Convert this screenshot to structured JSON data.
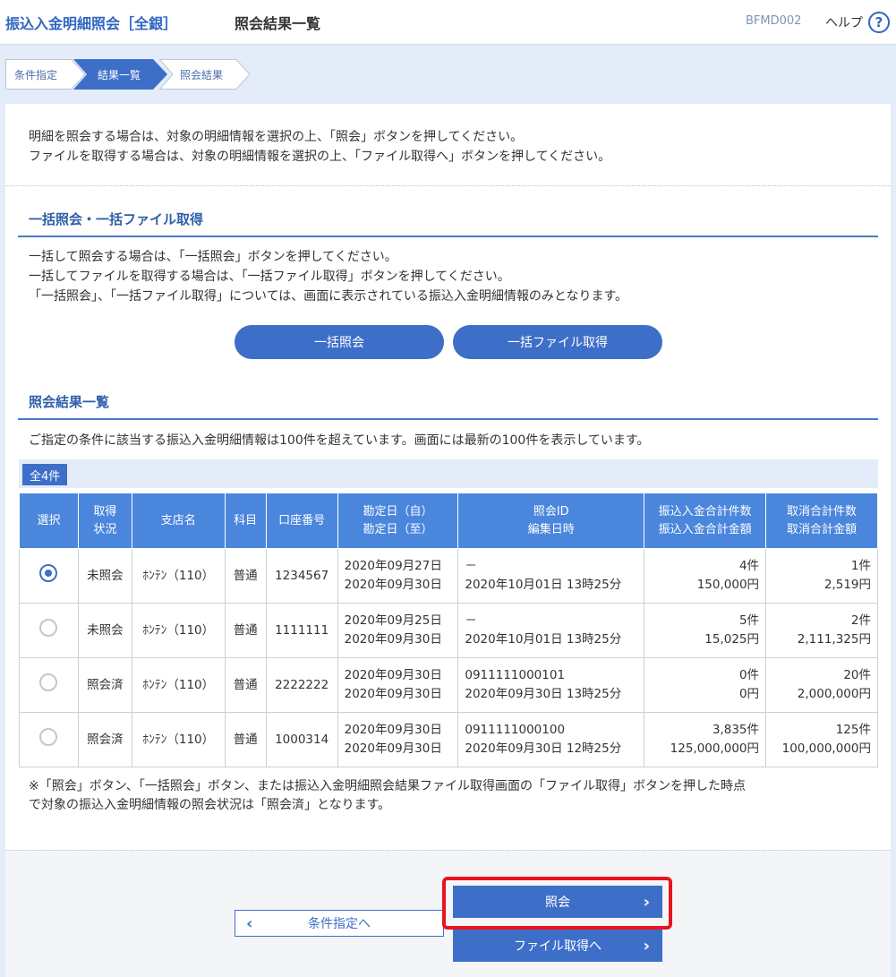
{
  "header": {
    "app_title": "振込入金明細照会［全銀］",
    "page_title": "照会結果一覧",
    "screen_id": "BFMD002",
    "help_label": "ヘルプ",
    "help_icon": "?"
  },
  "steps": [
    {
      "label": "条件指定",
      "state": "done"
    },
    {
      "label": "結果一覧",
      "state": "current"
    },
    {
      "label": "照会結果",
      "state": "pending"
    }
  ],
  "intro": [
    "明細を照会する場合は、対象の明細情報を選択の上、「照会」ボタンを押してください。",
    "ファイルを取得する場合は、対象の明細情報を選択の上、「ファイル取得へ」ボタンを押してください。"
  ],
  "bulk": {
    "title": "一括照会・一括ファイル取得",
    "lines": [
      "一括して照会する場合は、「一括照会」ボタンを押してください。",
      "一括してファイルを取得する場合は、「一括ファイル取得」ボタンを押してください。",
      "「一括照会」、「一括ファイル取得」については、画面に表示されている振込入金明細情報のみとなります。"
    ],
    "bulk_inquiry_label": "一括照会",
    "bulk_file_label": "一括ファイル取得"
  },
  "results": {
    "title": "照会結果一覧",
    "message": "ご指定の条件に該当する振込入金明細情報は100件を超えています。画面には最新の100件を表示しています。",
    "count_badge": "全4件",
    "columns": {
      "select": "選択",
      "status_1": "取得",
      "status_2": "状況",
      "branch": "支店名",
      "subject": "科目",
      "account": "口座番号",
      "date_1": "勘定日（自）",
      "date_2": "勘定日（至）",
      "inquiry_1": "照会ID",
      "inquiry_2": "編集日時",
      "deposit_1": "振込入金合計件数",
      "deposit_2": "振込入金合計金額",
      "cancel_1": "取消合計件数",
      "cancel_2": "取消合計金額"
    },
    "rows": [
      {
        "selected": true,
        "status": "未照会",
        "branch": "ﾎﾝﾃﾝ（110）",
        "subject": "普通",
        "account": "1234567",
        "date_from": "2020年09月27日",
        "date_to": "2020年09月30日",
        "inquiry_id": "－",
        "edited": "2020年10月01日 13時25分",
        "deposit_count": "4件",
        "deposit_amount": "150,000円",
        "cancel_count": "1件",
        "cancel_amount": "2,519円"
      },
      {
        "selected": false,
        "status": "未照会",
        "branch": "ﾎﾝﾃﾝ（110）",
        "subject": "普通",
        "account": "1111111",
        "date_from": "2020年09月25日",
        "date_to": "2020年09月30日",
        "inquiry_id": "－",
        "edited": "2020年10月01日 13時25分",
        "deposit_count": "5件",
        "deposit_amount": "15,025円",
        "cancel_count": "2件",
        "cancel_amount": "2,111,325円"
      },
      {
        "selected": false,
        "status": "照会済",
        "branch": "ﾎﾝﾃﾝ（110）",
        "subject": "普通",
        "account": "2222222",
        "date_from": "2020年09月30日",
        "date_to": "2020年09月30日",
        "inquiry_id": "0911111000101",
        "edited": "2020年09月30日 13時25分",
        "deposit_count": "0件",
        "deposit_amount": "0円",
        "cancel_count": "20件",
        "cancel_amount": "2,000,000円"
      },
      {
        "selected": false,
        "status": "照会済",
        "branch": "ﾎﾝﾃﾝ（110）",
        "subject": "普通",
        "account": "1000314",
        "date_from": "2020年09月30日",
        "date_to": "2020年09月30日",
        "inquiry_id": "0911111000100",
        "edited": "2020年09月30日 12時25分",
        "deposit_count": "3,835件",
        "deposit_amount": "125,000,000円",
        "cancel_count": "125件",
        "cancel_amount": "100,000,000円"
      }
    ],
    "note_1": "※「照会」ボタン、「一括照会」ボタン、または振込入金明細照会結果ファイル取得画面の「ファイル取得」ボタンを押した時点",
    "note_2": "で対象の振込入金明細情報の照会状況は「照会済」となります。"
  },
  "footer": {
    "back_label": "条件指定へ",
    "inquiry_label": "照会",
    "file_label": "ファイル取得へ"
  },
  "colors": {
    "accent": "#3e6fc8",
    "header_blue": "#4a86dc",
    "highlight": "#e8141e"
  }
}
